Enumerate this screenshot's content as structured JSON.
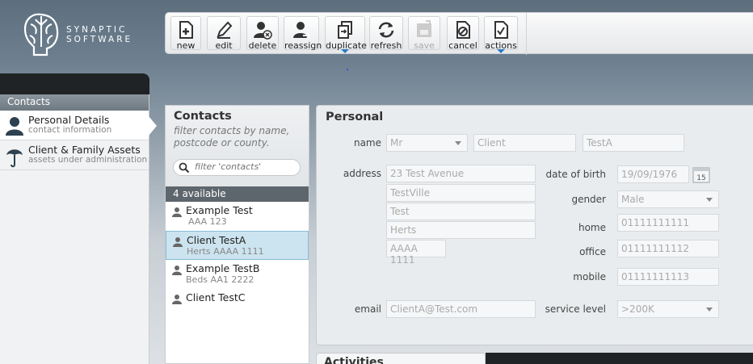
{
  "brand": {
    "line1": "SYNAPTIC",
    "line2": "SOFTWARE"
  },
  "toolbar": {
    "new": "new",
    "edit": "edit",
    "delete": "delete",
    "reassign": "reassign",
    "duplicate": "duplicate",
    "refresh": "refresh",
    "save": "save",
    "cancel": "cancel",
    "actions": "actions"
  },
  "sidebar": {
    "header": "Contacts",
    "items": [
      {
        "title": "Personal Details",
        "sub": "contact information"
      },
      {
        "title": "Client & Family Assets",
        "sub": "assets under administration"
      }
    ]
  },
  "contacts": {
    "title": "Contacts",
    "hint": "filter contacts by name, postcode or county.",
    "search_placeholder": "filter 'contacts'",
    "available": "4 available",
    "list": [
      {
        "name": "Example Test",
        "addr": "AAA 123"
      },
      {
        "name": "Client TestA",
        "addr": "Herts AAAA 1111"
      },
      {
        "name": "Example TestB",
        "addr": "Beds AA1 2222"
      },
      {
        "name": "Client TestC",
        "addr": ""
      }
    ]
  },
  "personal": {
    "title": "Personal",
    "labels": {
      "name": "name",
      "address": "address",
      "email": "email",
      "dob": "date of birth",
      "gender": "gender",
      "home": "home",
      "office": "office",
      "mobile": "mobile",
      "service": "service level"
    },
    "salutation": "Mr",
    "first_name": "Client",
    "last_name": "TestA",
    "address": [
      "23 Test Avenue",
      "TestVille",
      "Test",
      "Herts"
    ],
    "postcode": "AAAA 1111",
    "email": "ClientA@Test.com",
    "dob": "19/09/1976",
    "calendar_day": "15",
    "gender": "Male",
    "home": "01111111111",
    "office": "01111111112",
    "mobile": "01111111113",
    "service_level": ">200K"
  },
  "activities": {
    "title": "Activities"
  },
  "colors": {
    "accent": "#2b7bc4",
    "selection": "#cce4ef",
    "dark": "#1f2326"
  }
}
